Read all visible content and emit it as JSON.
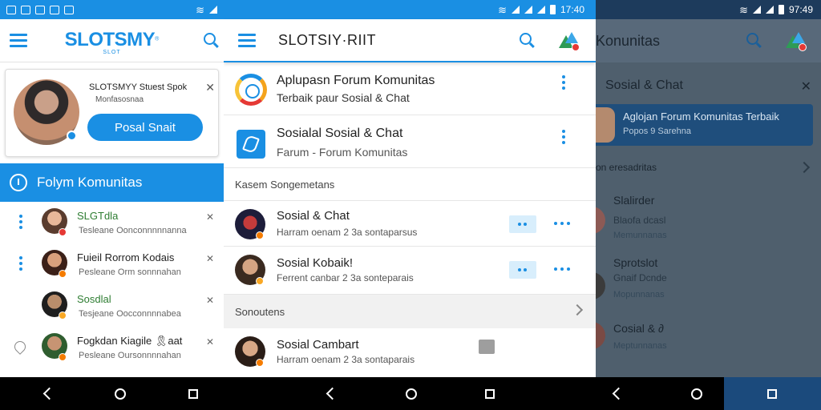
{
  "left": {
    "status_time": "",
    "brand": "SLOTSMY",
    "brand_reg": "®",
    "brand_sub": "SLOT",
    "profile": {
      "name": "SLOTSMYY Stuest Spok",
      "subtitle": "Monfasosnaa",
      "button_label": "Posal Snait"
    },
    "banner_label": "Folym Komunitas",
    "items": [
      {
        "title": "SLGTdla",
        "subtitle": "Tesleane Oonconnnnnanna"
      },
      {
        "title": "Fuieil Rorrom Kodais",
        "subtitle": "Pesleane Orm sonnnahan"
      },
      {
        "title": "Sosdlal",
        "subtitle": "Tesjeane Oocconnnnabea"
      },
      {
        "title": "Fogkdan Kiagile 🎗aat",
        "subtitle": "Pesleane Oursonnnnahan"
      }
    ]
  },
  "middle": {
    "status_time": "17:40",
    "title": "SLOTSIY·RIIT",
    "rows": [
      {
        "title": "Aplupasn Forum Komunitas",
        "subtitle": "Terbaik paur Sosial & Chat"
      },
      {
        "title": "Sosialal Sosial & Chat",
        "subtitle": "Farum - Forum Komunitas"
      }
    ],
    "section_label": "Kasem Songemetans",
    "chats": [
      {
        "title": "Sosial & Chat",
        "subtitle": "Harram oenam  2 3a sontaparsus"
      },
      {
        "title": "Sosial Kobaik!",
        "subtitle": "Ferrent canbar  2 3a sonteparais"
      }
    ],
    "gray_section_label": "Sonoutens",
    "last_chat": {
      "title": "Sosial Cambart",
      "subtitle": "Harram oenam  2 3a sontaparais"
    }
  },
  "right": {
    "status_time": "97:49",
    "title": "Konunitas",
    "header": "Sosial & Chat",
    "card": {
      "title": "Aglojan Forum Komunitas Terbaik",
      "subtitle": "Popos 9 Sarehna"
    },
    "section_label": "on eresadritas",
    "items": [
      {
        "title": "Slalirder",
        "subtitle": "Blaofa dcasl",
        "meta": "Memunnanas"
      },
      {
        "title": "Sprotslot",
        "subtitle": "Gnaif Dcnde",
        "meta": "Mopunnanas"
      },
      {
        "title": "Cosial & ∂",
        "subtitle": "",
        "meta": "Meptunnanas"
      }
    ]
  },
  "colors": {
    "accent": "#1a8fe3",
    "right_dark": "#4f5f6d",
    "nav": "#000000"
  }
}
